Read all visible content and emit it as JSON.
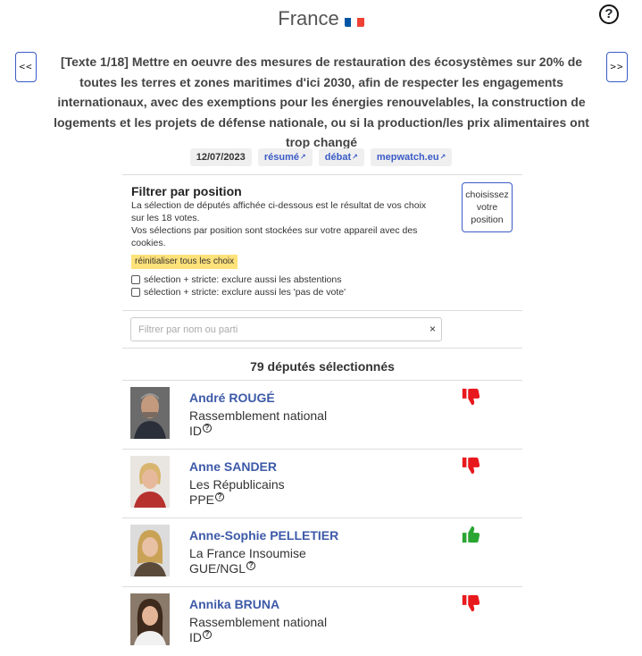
{
  "header": {
    "country": "France",
    "flag_icon": "france-flag-icon",
    "help_icon": "question-circle-icon"
  },
  "nav": {
    "prev_label": "<<",
    "next_label": ">>"
  },
  "vote": {
    "title": "[Texte 1/18] Mettre en oeuvre des mesures de restauration des écosystèmes sur 20% de toutes les terres et zones maritimes d'ici 2030, afin de respecter les engagements internationaux, avec des exemptions pour les énergies renouvelables, la construction de logements et les projets de défense nationale, ou si la production/les prix alimentaires ont trop changé",
    "date": "12/07/2023",
    "links": [
      "résumé",
      "débat",
      "mepwatch.eu"
    ]
  },
  "filter": {
    "heading": "Filtrer par position",
    "desc1": "La sélection de députés affichée ci-dessous est le résultat de vos choix sur les 18 votes.",
    "desc2": "Vos sélections par position sont stockées sur votre appareil avec des cookies.",
    "choose_button": "choisissez votre position",
    "reset_label": "réinitialiser tous les choix",
    "check_abstentions": "sélection + stricte: exclure aussi les abstentions",
    "check_no_vote": "sélection + stricte: exclure aussi les 'pas de vote'"
  },
  "search": {
    "placeholder": "Filtrer par nom ou parti",
    "clear": "×"
  },
  "selection": {
    "count_text": "79 députés sélectionnés"
  },
  "colors": {
    "accent": "#3b5bc7",
    "name": "#3d5aa8",
    "against": "#e8191d",
    "for": "#2aa532",
    "reset_bg": "#ffe27a"
  },
  "meps": [
    {
      "name": "André ROUGÉ",
      "party": "Rassemblement national",
      "group": "ID",
      "vote": "against"
    },
    {
      "name": "Anne SANDER",
      "party": "Les Républicains",
      "group": "PPE",
      "vote": "against"
    },
    {
      "name": "Anne-Sophie PELLETIER",
      "party": "La France Insoumise",
      "group": "GUE/NGL",
      "vote": "for"
    },
    {
      "name": "Annika BRUNA",
      "party": "Rassemblement national",
      "group": "ID",
      "vote": "against"
    }
  ]
}
